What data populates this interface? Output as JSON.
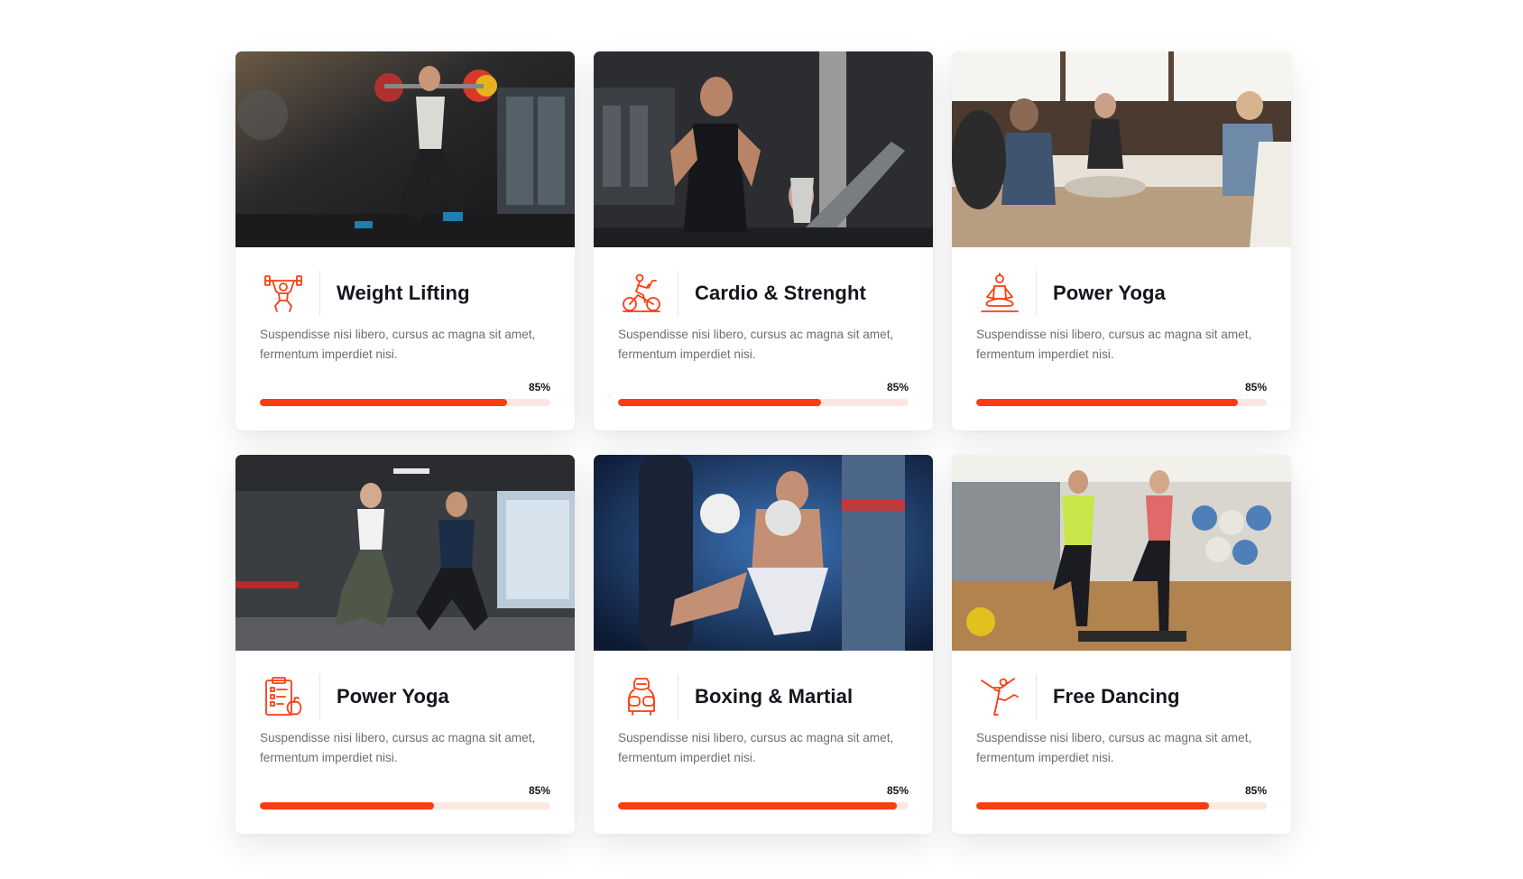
{
  "accent_color": "#fb3d12",
  "track_color": "#fde7e1",
  "cards": [
    {
      "title": "Weight Lifting",
      "icon": "weightlifter-icon",
      "description": "Suspendisse nisi libero, cursus ac magna sit amet, fermentum imperdiet nisi.",
      "progress_label": "85%",
      "progress_fill": 0.85,
      "photo": "woman-lunge-with-barbell-photo"
    },
    {
      "title": "Cardio & Strenght",
      "icon": "exercise-bike-icon",
      "description": "Suspendisse nisi libero, cursus ac magna sit amet, fermentum imperdiet nisi.",
      "progress_label": "85%",
      "progress_fill": 0.7,
      "photo": "man-running-treadmill-photo"
    },
    {
      "title": "Power Yoga",
      "icon": "meditation-icon",
      "description": "Suspendisse nisi libero, cursus ac magna sit amet, fermentum imperdiet nisi.",
      "progress_label": "85%",
      "progress_fill": 0.9,
      "photo": "yoga-class-photo"
    },
    {
      "title": "Power Yoga",
      "icon": "clipboard-apple-icon",
      "description": "Suspendisse nisi libero, cursus ac magna sit amet, fermentum imperdiet nisi.",
      "progress_label": "85%",
      "progress_fill": 0.6,
      "photo": "couple-dumbbell-lunge-photo"
    },
    {
      "title": "Boxing & Martial",
      "icon": "boxer-icon",
      "description": "Suspendisse nisi libero, cursus ac magna sit amet, fermentum imperdiet nisi.",
      "progress_label": "85%",
      "progress_fill": 0.96,
      "photo": "kickboxer-punching-bag-photo"
    },
    {
      "title": "Free Dancing",
      "icon": "dancer-icon",
      "description": "Suspendisse nisi libero, cursus ac magna sit amet, fermentum imperdiet nisi.",
      "progress_label": "85%",
      "progress_fill": 0.8,
      "photo": "step-aerobics-class-photo"
    }
  ]
}
